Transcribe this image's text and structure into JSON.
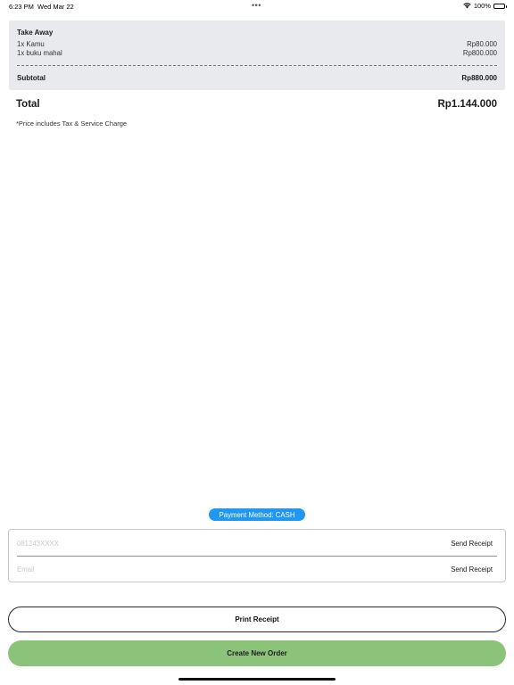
{
  "status_bar": {
    "time": "6:23 PM",
    "date": "Wed Mar 22",
    "dots": "•••",
    "battery": "100%",
    "wifi_icon": "wifi-icon",
    "battery_icon": "battery-icon"
  },
  "order": {
    "type": "Take Away",
    "items": [
      {
        "name": "1x Kamu",
        "price": "Rp80.000"
      },
      {
        "name": "1x buku mahal",
        "price": "Rp800.000"
      }
    ],
    "subtotal_label": "Subtotal",
    "subtotal_value": "Rp880.000"
  },
  "total": {
    "label": "Total",
    "value": "Rp1.144.000",
    "note": "*Price includes Tax & Service Charge"
  },
  "payment": {
    "label": "Payment Method: CASH",
    "color": "#2196f3"
  },
  "receipt": {
    "phone_placeholder": "081243XXXX",
    "phone_value": "",
    "phone_send": "Send Receipt",
    "email_placeholder": "Email",
    "email_value": "",
    "email_send": "Send Receipt"
  },
  "actions": {
    "print": "Print Receipt",
    "new_order": "Create New Order",
    "new_order_color": "#8cc37a"
  }
}
